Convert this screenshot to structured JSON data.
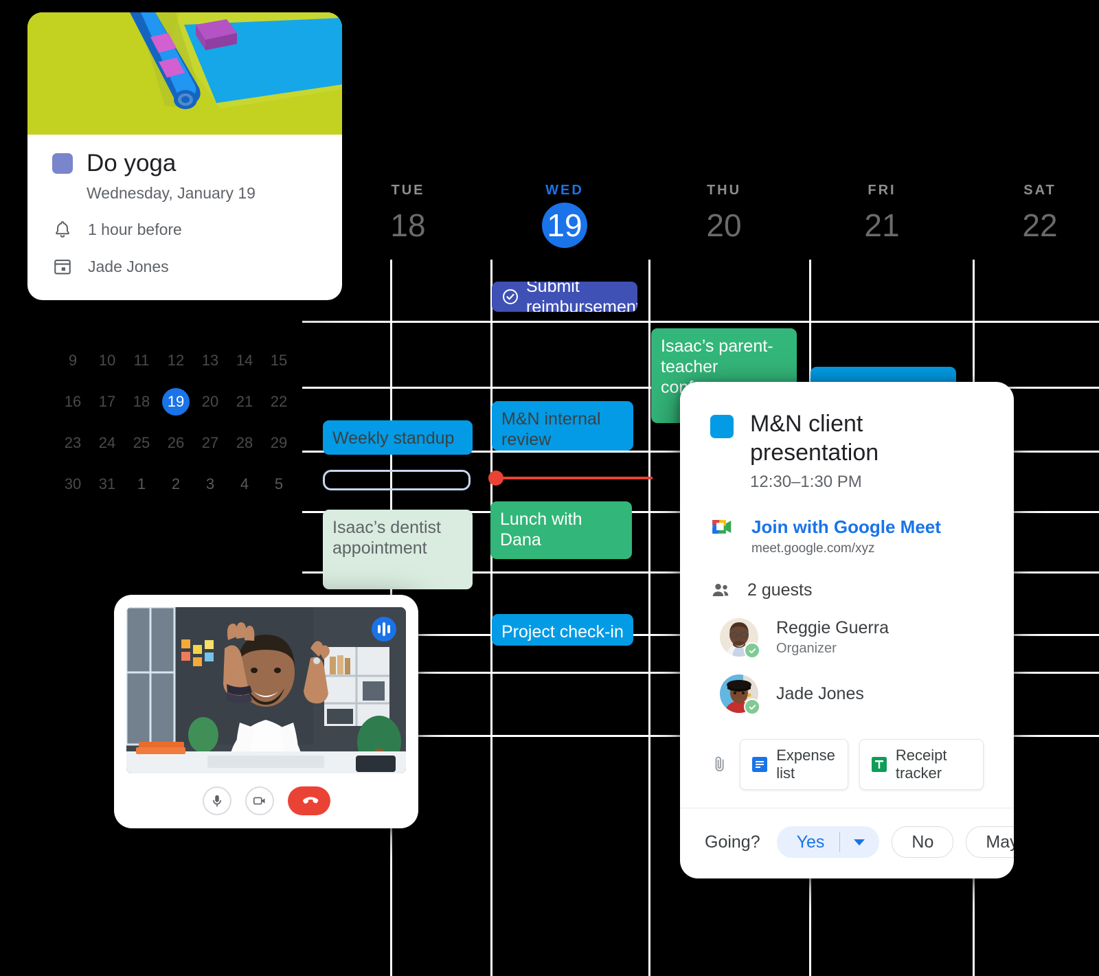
{
  "calendar": {
    "days": [
      {
        "abbr": "TUE",
        "num": "18",
        "today": false
      },
      {
        "abbr": "WED",
        "num": "19",
        "today": true
      },
      {
        "abbr": "THU",
        "num": "20",
        "today": false
      },
      {
        "abbr": "FRI",
        "num": "21",
        "today": false
      },
      {
        "abbr": "SAT",
        "num": "22",
        "today": false
      }
    ],
    "events": [
      {
        "title": "Submit reimbursement",
        "style": "indigo",
        "icon": "check-circle-icon"
      },
      {
        "title": "Isaac’s parent-teacher conferences",
        "style": "green"
      },
      {
        "title": "Weekly standup",
        "style": "blue"
      },
      {
        "title": "M&N internal review",
        "style": "blue"
      },
      {
        "title": "",
        "style": "outline"
      },
      {
        "title": "Isaac’s dentist appointment",
        "style": "mint"
      },
      {
        "title": "Lunch with Dana",
        "style": "green"
      },
      {
        "title": "Project check-in",
        "style": "blue-w"
      },
      {
        "title": "",
        "style": "blue"
      }
    ],
    "accent": "#1a73e8",
    "now_indicator_color": "#ea4335"
  },
  "mini_calendar": {
    "selected": "19",
    "rows": [
      [
        "9",
        "10",
        "11",
        "12",
        "13",
        "14",
        "15"
      ],
      [
        "16",
        "17",
        "18",
        "19",
        "20",
        "21",
        "22"
      ],
      [
        "23",
        "24",
        "25",
        "26",
        "27",
        "28",
        "29"
      ],
      [
        "30",
        "31",
        "1",
        "2",
        "3",
        "4",
        "5"
      ]
    ]
  },
  "yoga_card": {
    "title": "Do yoga",
    "date": "Wednesday, January 19",
    "reminder": "1 hour before",
    "calendar_owner": "Jade Jones",
    "color": "#7986cb"
  },
  "video_call": {
    "mic_label": "microphone",
    "camera_label": "camera",
    "end_label": "end call"
  },
  "detail_popup": {
    "title": "M&N client presentation",
    "time": "12:30–1:30 PM",
    "color": "#039be5",
    "meet_link": "Join with Google Meet",
    "meet_url": "meet.google.com/xyz",
    "guest_count": "2 guests",
    "guests": [
      {
        "name": "Reggie Guerra",
        "role": "Organizer",
        "accepted": true
      },
      {
        "name": "Jade Jones",
        "role": "",
        "accepted": true
      }
    ],
    "attachments": [
      {
        "label": "Expense list",
        "kind": "docs"
      },
      {
        "label": "Receipt tracker",
        "kind": "sheets"
      }
    ],
    "rsvp": {
      "prompt": "Going?",
      "yes": "Yes",
      "no": "No",
      "maybe": "Maybe",
      "selected": "Yes"
    }
  }
}
